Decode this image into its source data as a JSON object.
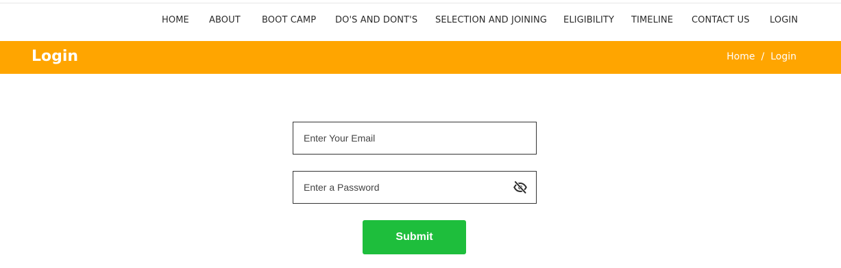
{
  "nav": {
    "items": [
      {
        "label": "HOME"
      },
      {
        "label": "ABOUT"
      },
      {
        "label": "BOOT CAMP"
      },
      {
        "label": "DO'S AND DONT'S"
      },
      {
        "label": "SELECTION AND JOINING"
      },
      {
        "label": "ELIGIBILITY"
      },
      {
        "label": "TIMELINE"
      },
      {
        "label": "CONTACT US"
      },
      {
        "label": "LOGIN"
      }
    ]
  },
  "banner": {
    "title": "Login",
    "breadcrumb": {
      "home": "Home",
      "separator": "/",
      "current": "Login"
    },
    "color": "#ffa500"
  },
  "form": {
    "email": {
      "placeholder": "Enter Your Email",
      "value": ""
    },
    "password": {
      "placeholder": "Enter a Password",
      "value": "",
      "toggle_icon": "eye-slash-icon"
    },
    "submit_label": "Submit",
    "submit_color": "#1ebe3c"
  }
}
